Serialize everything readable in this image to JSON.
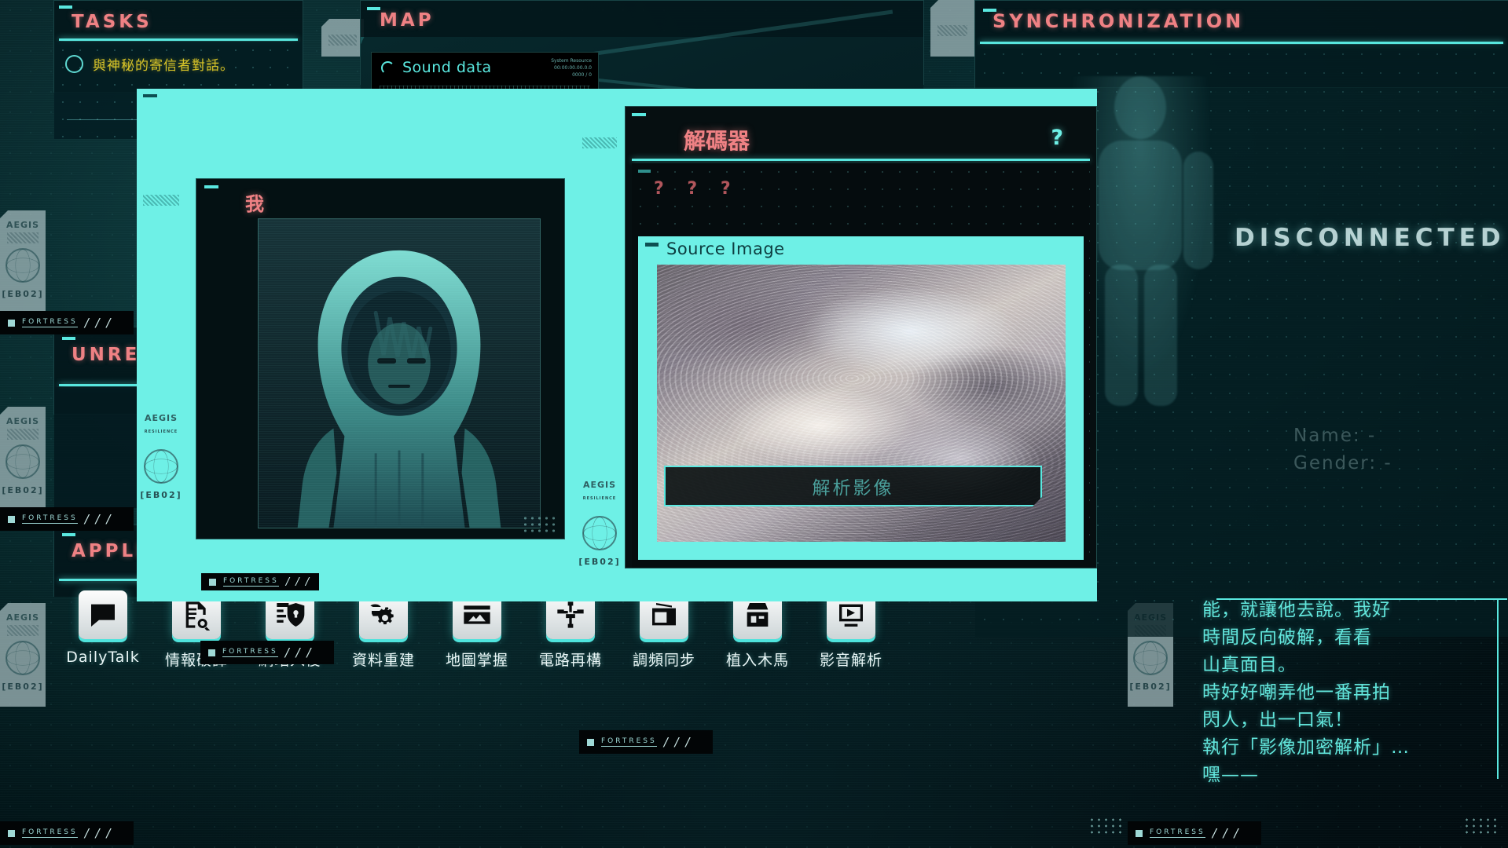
{
  "theme": {
    "accent_cyan": "#5ae8e0",
    "bright_cyan": "#6ef0e6",
    "title_red": "#ef8184",
    "task_yellow": "#d8c428",
    "bg_dark": "#030b0c"
  },
  "panels": {
    "tasks": {
      "title": "TASKS",
      "items": [
        {
          "text": "與神秘的寄信者對話。",
          "done": false
        }
      ]
    },
    "map": {
      "title": "MAP",
      "sound_window": {
        "title": "Sound data",
        "icon": "loading-spinner-icon",
        "meta_lines": [
          "System Resource",
          "00:00:00.00.0.0",
          "0000 / 0"
        ]
      }
    },
    "sync": {
      "title": "SYNCHRONIZATION",
      "status": "DISCONNECTED",
      "fields": [
        {
          "label": "Name: -"
        },
        {
          "label": "Gender: -"
        }
      ]
    },
    "mail": {
      "title": "UNREAD MAIL"
    },
    "applications": {
      "title": "APPLICATIONS"
    }
  },
  "dock": {
    "items": [
      {
        "label": "DailyTalk",
        "icon": "chat-bubble-icon"
      },
      {
        "label": "情報破譯",
        "icon": "document-search-icon"
      },
      {
        "label": "網站入侵",
        "icon": "shield-code-icon"
      },
      {
        "label": "資料重建",
        "icon": "gear-wrench-icon"
      },
      {
        "label": "地圖掌握",
        "icon": "map-fold-icon"
      },
      {
        "label": "電路再構",
        "icon": "circuit-icon"
      },
      {
        "label": "調頻同步",
        "icon": "radio-tune-icon"
      },
      {
        "label": "植入木馬",
        "icon": "trojan-icon"
      },
      {
        "label": "影音解析",
        "icon": "media-analysis-icon"
      }
    ]
  },
  "avatar_window": {
    "title": "我",
    "photo_alt": "hooded-figure-portrait"
  },
  "decoder_window": {
    "title": "解碼器",
    "help_label": "?",
    "unknown_label": "? ? ?",
    "source_panel": {
      "title": "Source Image",
      "image_alt": "encrypted-cloud-topography"
    },
    "analyze_button": "解析影像"
  },
  "chat": {
    "lines": [
      "能，就讓他去說。我好",
      "時間反向破解，看看",
      "山真面目。",
      "時好好嘲弄他一番再拍",
      "閃人，出一口氣！",
      "執行「影像加密解析」…",
      "嘿——"
    ]
  },
  "branding": {
    "fortress_label": "FORTRESS",
    "slashes": "/ / /",
    "aegis_label": "AEGIS",
    "aegis_sub": "RESILIENCE",
    "unit_code": "[EB02]"
  }
}
